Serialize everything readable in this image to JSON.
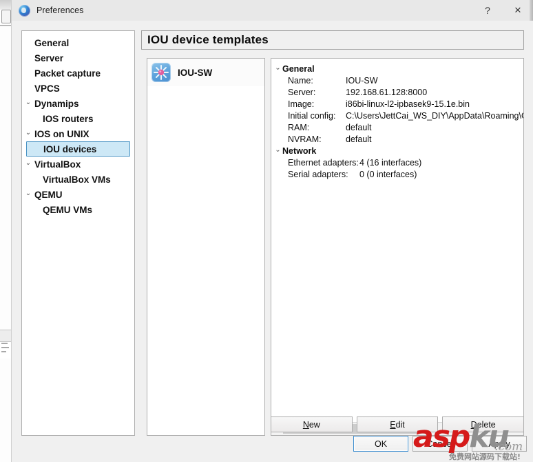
{
  "window": {
    "title": "Preferences",
    "app_icon": "gns3-globe-icon",
    "controls": {
      "help": "?",
      "close": "×"
    }
  },
  "sidebar": {
    "items": [
      {
        "label": "General",
        "depth": 0,
        "expandable": false,
        "selected": false
      },
      {
        "label": "Server",
        "depth": 0,
        "expandable": false,
        "selected": false
      },
      {
        "label": "Packet capture",
        "depth": 0,
        "expandable": false,
        "selected": false
      },
      {
        "label": "VPCS",
        "depth": 0,
        "expandable": false,
        "selected": false
      },
      {
        "label": "Dynamips",
        "depth": 0,
        "expandable": true,
        "selected": false
      },
      {
        "label": "IOS routers",
        "depth": 1,
        "expandable": false,
        "selected": false
      },
      {
        "label": "IOS on UNIX",
        "depth": 0,
        "expandable": true,
        "selected": false
      },
      {
        "label": "IOU devices",
        "depth": 1,
        "expandable": false,
        "selected": true
      },
      {
        "label": "VirtualBox",
        "depth": 0,
        "expandable": true,
        "selected": false
      },
      {
        "label": "VirtualBox VMs",
        "depth": 1,
        "expandable": false,
        "selected": false
      },
      {
        "label": "QEMU",
        "depth": 0,
        "expandable": true,
        "selected": false
      },
      {
        "label": "QEMU VMs",
        "depth": 1,
        "expandable": false,
        "selected": false
      }
    ],
    "chevron_glyph": "⌄"
  },
  "main": {
    "section_title": "IOU device templates",
    "device_list": [
      {
        "name": "IOU-SW",
        "icon": "multilayer-switch-icon",
        "selected": true
      }
    ],
    "properties": {
      "groups": [
        {
          "name": "General",
          "rows": [
            {
              "key": "Name:",
              "value": "IOU-SW"
            },
            {
              "key": "Server:",
              "value": "192.168.61.128:8000"
            },
            {
              "key": "Image:",
              "value": "i86bi-linux-l2-ipbasek9-15.1e.bin"
            },
            {
              "key": "Initial config:",
              "value": "C:\\Users\\JettCai_WS_DIY\\AppData\\Roaming\\GN"
            },
            {
              "key": "RAM:",
              "value": "default"
            },
            {
              "key": "NVRAM:",
              "value": "default"
            }
          ]
        },
        {
          "name": "Network",
          "wide_keys": true,
          "rows": [
            {
              "key": "Ethernet adapters:",
              "value": "4 (16 interfaces)"
            },
            {
              "key": "Serial adapters:",
              "value": "0 (0 interfaces)"
            }
          ]
        }
      ],
      "scrollbar": {
        "left_arrow": "‹",
        "right_arrow": "›",
        "thumb_width_pct": 62
      }
    },
    "action_buttons": [
      {
        "label": "New",
        "mnemonic": "N"
      },
      {
        "label": "Edit",
        "mnemonic": "E"
      },
      {
        "label": "Delete",
        "mnemonic": "D"
      }
    ]
  },
  "footer": {
    "buttons": [
      {
        "label": "OK",
        "primary": true
      },
      {
        "label": "Cancel",
        "primary": false
      },
      {
        "label": "Apply",
        "primary": false
      }
    ]
  },
  "watermark": {
    "part_red": "asp",
    "part_gray": "ku",
    "domain": ".com",
    "tagline": "免费网站源码下载站!"
  },
  "colors": {
    "selection_bg": "#cde8f6",
    "selection_border": "#4a93c4",
    "dialog_bg": "#f0f0f0",
    "panel_bg": "#ffffff",
    "watermark_red": "#d51a1a",
    "watermark_gray": "#8f8f8f",
    "primary_button_border": "#3f8fd0"
  }
}
